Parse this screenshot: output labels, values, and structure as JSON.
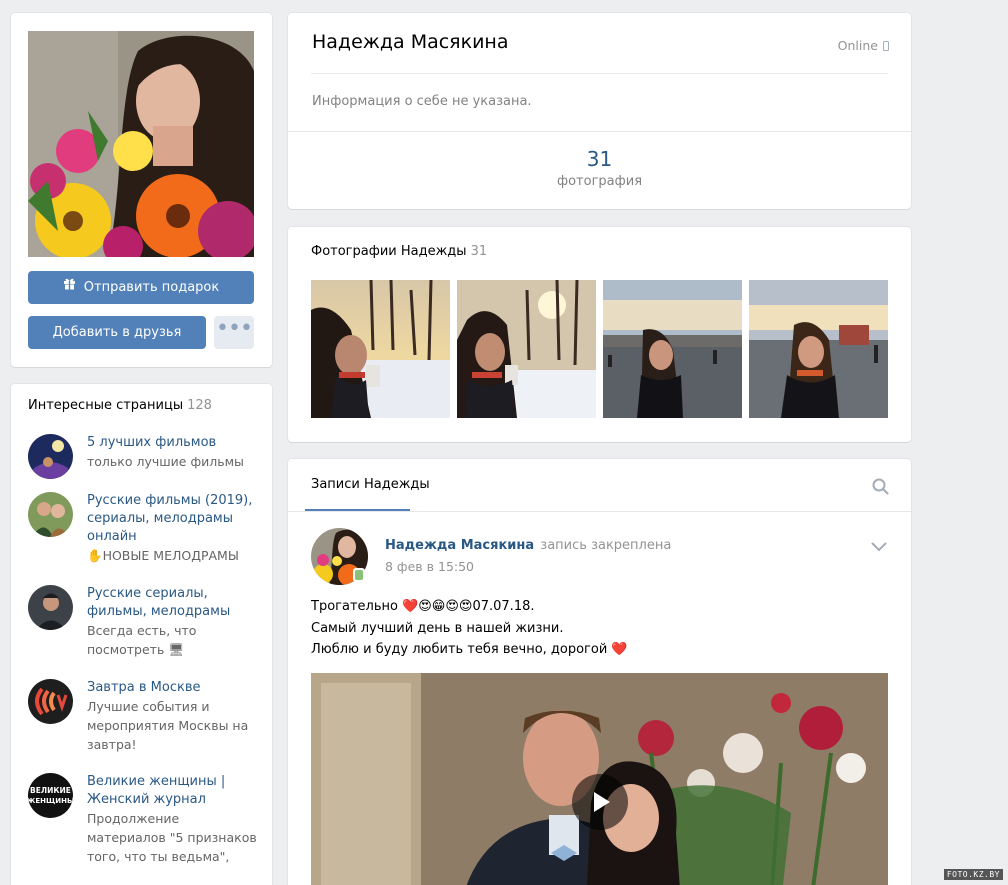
{
  "profile": {
    "name": "Надежда Масякина",
    "status": "Online",
    "about": "Информация о себе не указана.",
    "counter_value": "31",
    "counter_label": "фотография"
  },
  "actions": {
    "gift_label": "Отправить подарок",
    "add_friend_label": "Добавить в друзья",
    "more_label": "•••"
  },
  "interests": {
    "title": "Интересные страницы",
    "count": "128",
    "items": [
      {
        "name": "5 лучших фильмов",
        "desc": "только лучшие фильмы",
        "icon": "aladdin-avatar"
      },
      {
        "name": "Русские фильмы (2019), сериалы, мелодрамы онлайн",
        "desc": "✋НОВЫЕ МЕЛОДРАМЫ",
        "icon": "couple-avatar"
      },
      {
        "name": "Русские сериалы, фильмы, мелодрамы",
        "desc": "Всегда есть, что посмотреть 🖥",
        "icon": "man-avatar"
      },
      {
        "name": "Завтра в Москве",
        "desc": "Лучшие события и мероприятия Москвы на завтра!",
        "icon": "moscow-logo-avatar"
      },
      {
        "name": "Великие женщины | Женский журнал",
        "desc": "Продолжение материалов \"5 признаков того, что ты ведьма\",",
        "icon": "women-magazine-avatar",
        "logo_text": "ВЕЛИКИЕ ЖЕНЩИНЫ"
      }
    ]
  },
  "photos": {
    "title": "Фотографии Надежды",
    "count": "31"
  },
  "wall": {
    "tab_label": "Записи Надежды",
    "post": {
      "author": "Надежда Масякина",
      "pinned": "запись закреплена",
      "date": "8 фев в 15:50",
      "line1": "Трогательно ❤️😍😁😍😍07.07.18.",
      "line2": "Самый лучший день в нашей жизни.",
      "line3": "Люблю и буду любить тебя вечно, дорогой ❤️"
    }
  },
  "watermark": "FOTO.KZ.BY",
  "colors": {
    "accent": "#5181b8",
    "link": "#2a5885",
    "background": "#edeef0"
  }
}
